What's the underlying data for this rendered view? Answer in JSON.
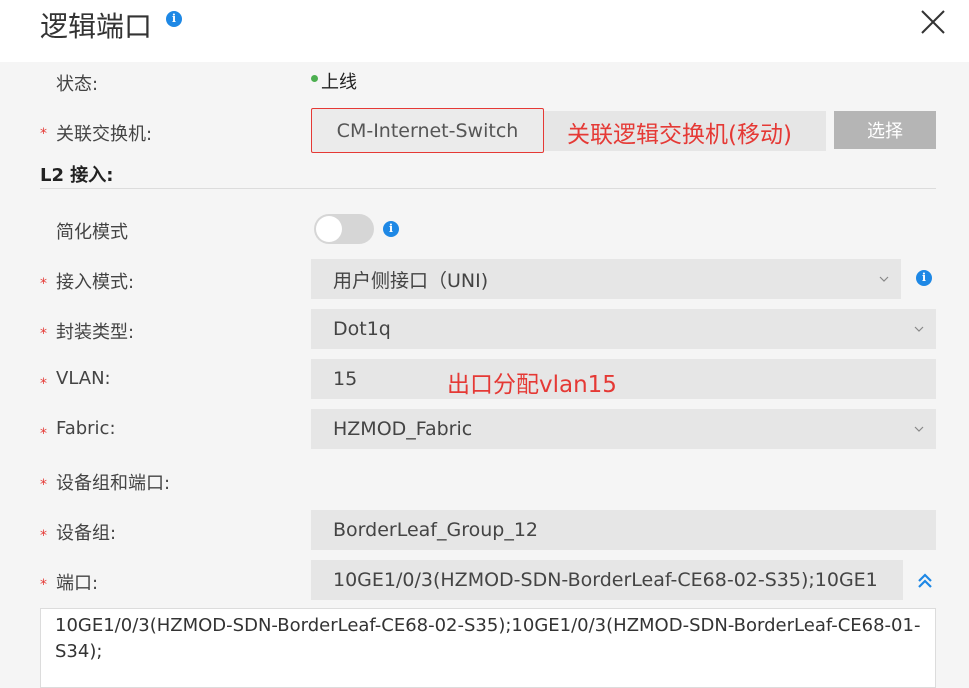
{
  "dialog": {
    "title": "逻辑端口"
  },
  "form": {
    "status": {
      "label": "状态:",
      "value": "上线"
    },
    "switch": {
      "label": "关联交换机:",
      "value": "CM-Internet-Switch",
      "annotation": "关联逻辑交换机(移动)",
      "select_label": "选择"
    },
    "l2_section": "L2 接入:",
    "simple_mode": {
      "label": "简化模式",
      "enabled": false
    },
    "access_mode": {
      "label": "接入模式:",
      "value": "用户侧接口（UNI)"
    },
    "encap_type": {
      "label": "封装类型:",
      "value": "Dot1q"
    },
    "vlan": {
      "label": "VLAN:",
      "value": "15",
      "annotation": "出口分配vlan15"
    },
    "fabric": {
      "label": "Fabric:",
      "value": "HZMOD_Fabric"
    },
    "device_group_port": {
      "label": "设备组和端口:"
    },
    "device_group": {
      "label": "设备组:",
      "value": "BorderLeaf_Group_12"
    },
    "port": {
      "label": "端口:",
      "value": "10GE1/0/3(HZMOD-SDN-BorderLeaf-CE68-02-S35);10GE1",
      "full_value": "10GE1/0/3(HZMOD-SDN-BorderLeaf-CE68-02-S35);10GE1/0/3(HZMOD-SDN-BorderLeaf-CE68-01-S34);"
    }
  },
  "required_mark": "*",
  "colors": {
    "accent": "#1e88e5",
    "required": "#e53935",
    "status_online": "#4caf50"
  }
}
